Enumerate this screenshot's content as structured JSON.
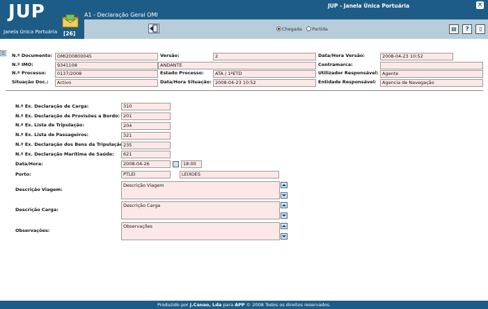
{
  "app": {
    "logo": "JUP",
    "logo_subtitle": "Janela Única Portuária",
    "window_title": "JUP - Janela Única Portuária",
    "page_title": "A1 - Declaração Geral OMI",
    "message_count": "[26]"
  },
  "toolbar": {
    "radio_arrival": "Chegada",
    "radio_departure": "Partida",
    "selected": "Chegada"
  },
  "header_fields": {
    "doc_no_label": "N.º Documento:",
    "doc_no_value": "OMI200800045",
    "version_label": "Versão:",
    "version_value": "2",
    "version_datetime_label": "Data/Hora Versão:",
    "version_datetime_value": "2008-04-23 10:52",
    "imo_label": "N.º IMO:",
    "imo_value": "9341108",
    "vessel_value": "ANDANTE",
    "counterpart_label": "Contramarca:",
    "counterpart_value": "",
    "process_label": "N.º Processo:",
    "process_value": "0137/2008",
    "process_state_label": "Estado Processo:",
    "process_state_value": "ATA /    1ºETD",
    "responsible_user_label": "Utilizador Responsável:",
    "responsible_user_value": "Agente",
    "doc_state_label": "Situação Doc.:",
    "doc_state_value": "Activo",
    "state_datetime_label": "Data/Hora Situação:",
    "state_datetime_value": "2008-04-23 10:52",
    "responsible_entity_label": "Entidade Responsável:",
    "responsible_entity_value": "Agencia de Navegação"
  },
  "body_fields": {
    "cargo_decl_label": "N.º Ex. Declaração de Carga:",
    "cargo_decl_value": "310",
    "provisions_label": "N.º Ex. Declaração de Provisões a Bordo:",
    "provisions_value": "201",
    "crew_list_label": "N.º Ex. Lista de Tripulação:",
    "crew_list_value": "204",
    "passenger_list_label": "N.º Ex. Lista de Passageiros:",
    "passenger_list_value": "321",
    "crew_goods_label": "N.º Ex. Declaração dos Bens da Tripulação:",
    "crew_goods_value": "235",
    "health_decl_label": "N.º Ex. Declaração Marítima de Saúde:",
    "health_decl_value": "621",
    "datetime_label": "Data/Hora:",
    "date_value": "2008-04-26",
    "time_value": "18:00",
    "port_label": "Porto:",
    "port_code": "PTLEI",
    "port_name": "LEIXOES",
    "voyage_label": "Descrição Viagem:",
    "voyage_value": "Descrição Viagem",
    "cargo_label": "Descrição Carga:",
    "cargo_value": "Descrição Carga",
    "notes_label": "Observações:",
    "notes_value": "Observações"
  },
  "footer": {
    "prefix": "Produzido por ",
    "company": "J.Canao, Lda",
    "middle": " para ",
    "app": "APP",
    "suffix": " © 2008 Todos os direitos reservados."
  }
}
